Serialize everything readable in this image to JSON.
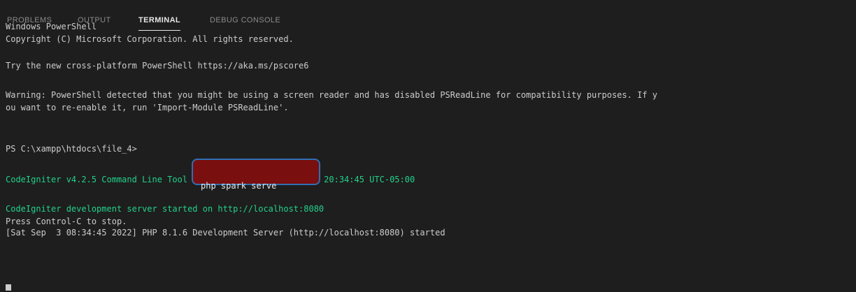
{
  "tabs": [
    {
      "label": "PROBLEMS",
      "active": false
    },
    {
      "label": "OUTPUT",
      "active": false
    },
    {
      "label": "TERMINAL",
      "active": true
    },
    {
      "label": "DEBUG CONSOLE",
      "active": false
    }
  ],
  "terminal": {
    "lines": [
      "Windows PowerShell",
      "Copyright (C) Microsoft Corporation. All rights reserved.",
      "Try the new cross-platform PowerShell https://aka.ms/pscore6",
      "Warning: PowerShell detected that you might be using a screen reader and has disabled PSReadLine for compatibility purposes. If y",
      "ou want to re-enable it, run 'Import-Module PSReadLine'.",
      "PS C:\\xampp\\htdocs\\file_4>",
      "CodeIgniter v4.2.5 Command Line Tool - Server Time: 2022-09-02 20:34:45 UTC-05:00",
      "CodeIgniter development server started on http://localhost:8080",
      "Press Control-C to stop.",
      "[Sat Sep  3 08:34:45 2022] PHP 8.1.6 Development Server (http://localhost:8080) started"
    ],
    "command": "php spark serve"
  },
  "colors": {
    "background": "#1e1e1e",
    "text": "#cccccc",
    "success_green": "#23d18b",
    "highlight_fill": "#7a0f0f",
    "highlight_border": "#2f6fb3"
  }
}
